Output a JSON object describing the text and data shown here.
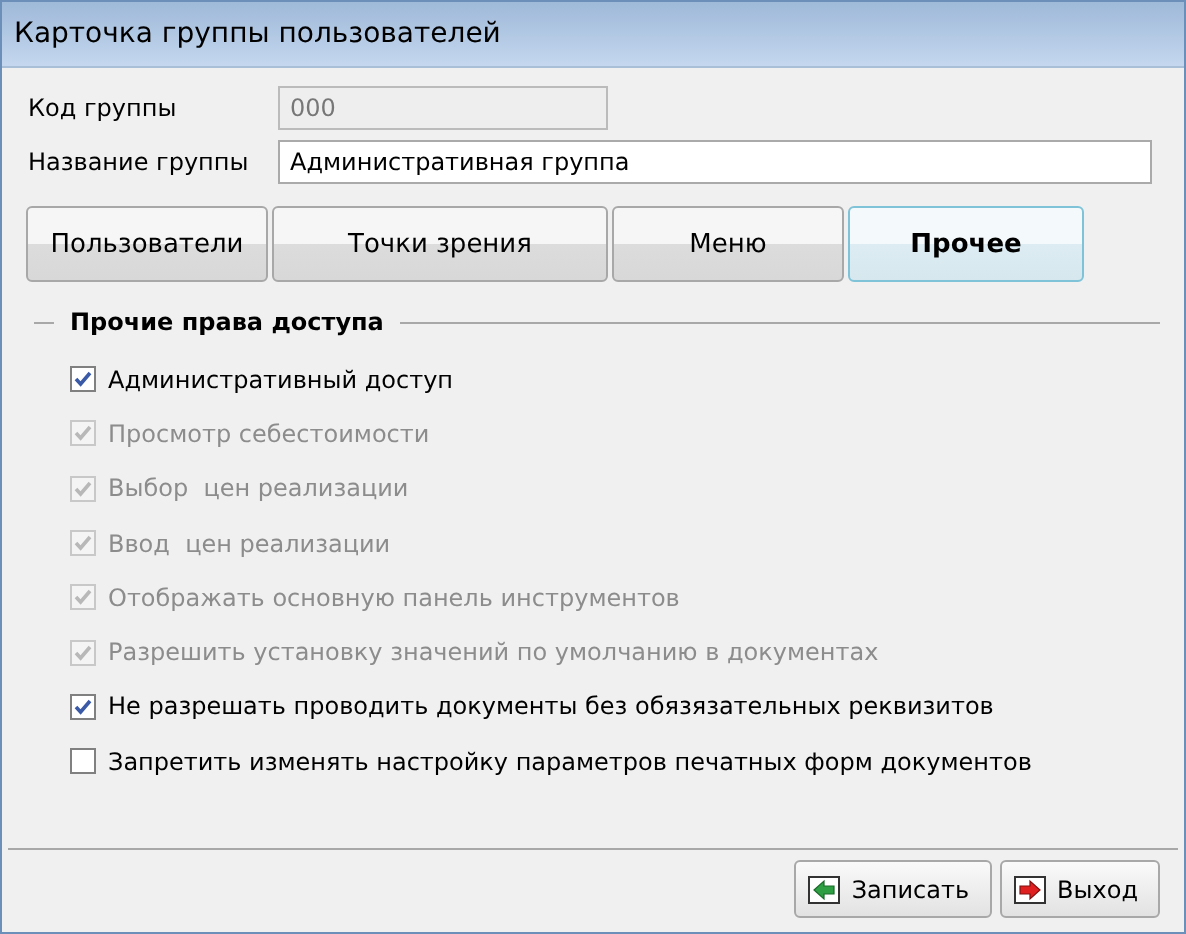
{
  "window": {
    "title": "Карточка группы пользователей"
  },
  "fields": [
    {
      "label": "Код группы",
      "value": "000",
      "disabled": true
    },
    {
      "label": "Название группы",
      "value": "Административная группа",
      "disabled": false
    }
  ],
  "tabs": [
    {
      "label": "Пользователи",
      "selected": false
    },
    {
      "label": "Точки зрения",
      "selected": false
    },
    {
      "label": "Меню",
      "selected": false
    },
    {
      "label": "Прочее",
      "selected": true
    }
  ],
  "group": {
    "title": "Прочие права доступа",
    "options": [
      {
        "label": "Административный доступ",
        "checked": true,
        "disabled": false
      },
      {
        "label": "Просмотр себестоимости",
        "checked": true,
        "disabled": true
      },
      {
        "label": "Выбор  цен реализации",
        "checked": true,
        "disabled": true
      },
      {
        "label": "Ввод  цен реализации",
        "checked": true,
        "disabled": true
      },
      {
        "label": "Отображать основную панель инструментов",
        "checked": true,
        "disabled": true
      },
      {
        "label": "Разрешить установку значений по умолчанию в документах",
        "checked": true,
        "disabled": true
      },
      {
        "label": "Не разрешать проводить документы без обязязательных реквизитов",
        "checked": true,
        "disabled": false
      },
      {
        "label": "Запретить изменять настройку параметров печатных форм документов",
        "checked": false,
        "disabled": false
      }
    ]
  },
  "buttons": [
    {
      "label": "Записать",
      "kind": "save"
    },
    {
      "label": "Выход",
      "kind": "exit"
    }
  ]
}
